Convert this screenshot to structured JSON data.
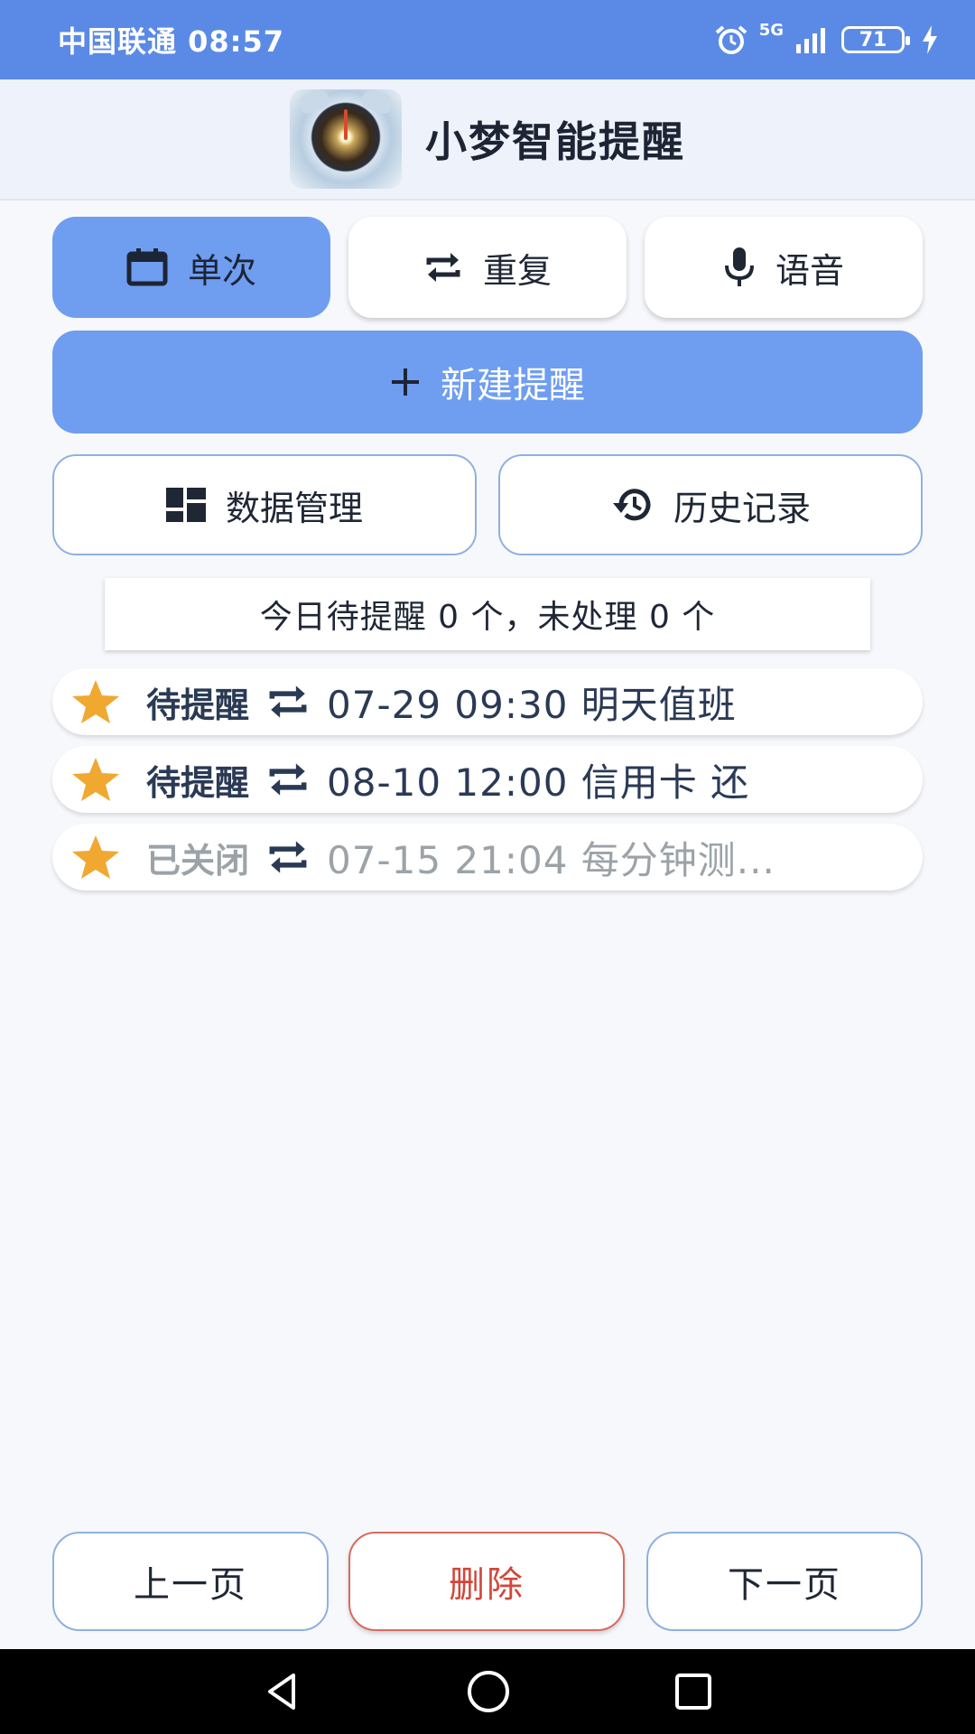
{
  "status_bar": {
    "carrier_time": "中国联通 08:57",
    "network": "5G",
    "battery": "71"
  },
  "app": {
    "title": "小梦智能提醒"
  },
  "modes": [
    {
      "label": "单次",
      "icon": "calendar-icon",
      "active": true
    },
    {
      "label": "重复",
      "icon": "repeat-icon",
      "active": false
    },
    {
      "label": "语音",
      "icon": "microphone-icon",
      "active": false
    }
  ],
  "actions": {
    "new_reminder": "新建提醒",
    "data_management": "数据管理",
    "history": "历史记录"
  },
  "summary": "今日待提醒 0 个，未处理 0 个",
  "reminders": [
    {
      "status": "待提醒",
      "text": "07-29 09:30 明天值班",
      "closed": false
    },
    {
      "status": "待提醒",
      "text": "08-10 12:00 信用卡 还",
      "closed": false
    },
    {
      "status": "已关闭",
      "text": "07-15 21:04 每分钟测...",
      "closed": true
    }
  ],
  "pagination": {
    "prev": "上一页",
    "delete": "删除",
    "next": "下一页"
  },
  "colors": {
    "accent": "#6f9df0",
    "status_bar": "#5b8ae6",
    "star": "#f0a830",
    "delete": "#d0483a"
  }
}
